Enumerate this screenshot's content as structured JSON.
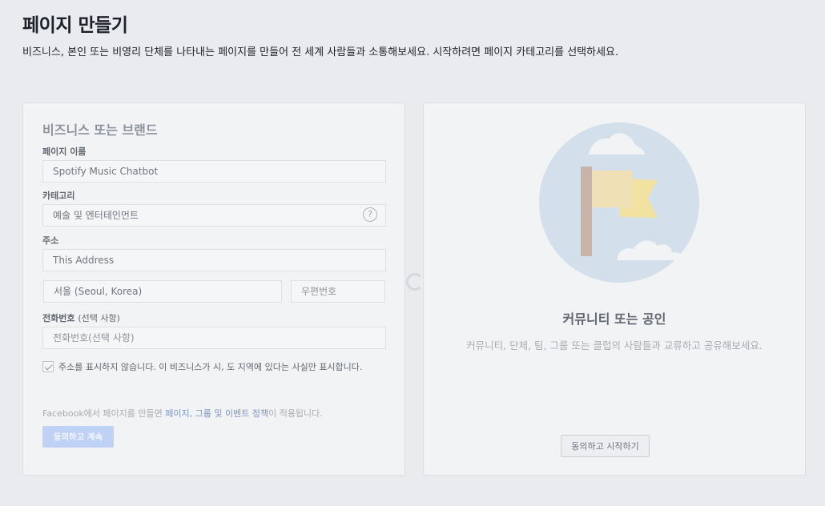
{
  "header": {
    "title": "페이지 만들기",
    "subtitle": "비즈니스, 본인 또는 비영리 단체를 나타내는 페이지를 만들어 전 세계 사람들과 소통해보세요. 시작하려면 페이지 카테고리를 선택하세요."
  },
  "business_card": {
    "heading": "비즈니스 또는 브랜드",
    "page_name": {
      "label": "페이지 이름",
      "value": "Spotify Music Chatbot"
    },
    "category": {
      "label": "카테고리",
      "value": "예술 및 엔터테인먼트",
      "help_glyph": "?"
    },
    "address": {
      "label": "주소",
      "street_value": "This Address",
      "city_value": "서울 (Seoul, Korea)",
      "zip_placeholder": "우편번호"
    },
    "phone": {
      "label": "전화번호",
      "label_optional": "(선택 사항)",
      "placeholder": "전화번호(선택 사항)"
    },
    "hide_address": {
      "checked": true,
      "label": "주소를 표시하지 않습니다. 이 비즈니스가 시, 도 지역에 있다는 사실만 표시합니다."
    },
    "terms": {
      "prefix": "Facebook에서 페이지를 만들면 ",
      "link": "페이지, 그룹 및 이벤트 정책",
      "suffix": "이 적용됩니다."
    },
    "continue_button": "동의하고 계속"
  },
  "community_card": {
    "heading": "커뮤니티 또는 공인",
    "description": "커뮤니티, 단체, 팀, 그룹 또는 클럽의 사람들과 교류하고 공유해보세요.",
    "start_button": "동의하고 시작하기"
  },
  "colors": {
    "background": "#e9ebee",
    "card": "#f2f3f5",
    "primary_disabled": "#bfd2f5",
    "link": "#7b95c0",
    "illustration_circle": "#d3dfea",
    "flag": "#f0e0b5",
    "flag_tail": "#f2e2a2",
    "pole": "#c8b4a8"
  }
}
